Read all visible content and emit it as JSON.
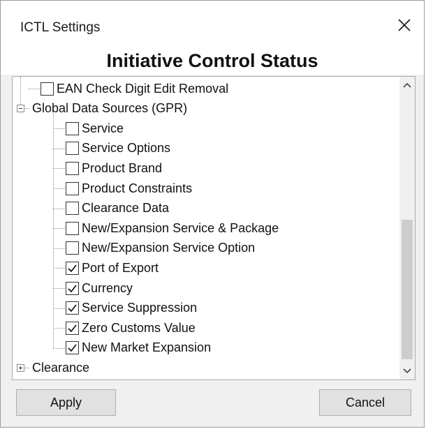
{
  "window": {
    "title": "ICTL Settings",
    "header": "Initiative Control Status"
  },
  "tree": {
    "items": [
      {
        "label": "EAN Check Digit Edit Removal",
        "checked": false,
        "level": 1
      },
      {
        "label": "Global Data Sources (GPR)",
        "node": true,
        "expanded": true,
        "level": 0
      },
      {
        "label": "Service",
        "checked": false,
        "level": 1
      },
      {
        "label": "Service Options",
        "checked": false,
        "level": 1
      },
      {
        "label": "Product Brand",
        "checked": false,
        "level": 1
      },
      {
        "label": "Product Constraints",
        "checked": false,
        "level": 1
      },
      {
        "label": "Clearance Data",
        "checked": false,
        "level": 1
      },
      {
        "label": "New/Expansion Service & Package",
        "checked": false,
        "level": 1
      },
      {
        "label": "New/Expansion Service Option",
        "checked": false,
        "level": 1
      },
      {
        "label": "Port of Export",
        "checked": true,
        "level": 1
      },
      {
        "label": "Currency",
        "checked": true,
        "level": 1
      },
      {
        "label": "Service Suppression",
        "checked": true,
        "level": 1
      },
      {
        "label": "Zero Customs Value",
        "checked": true,
        "level": 1
      },
      {
        "label": "New Market Expansion",
        "checked": true,
        "level": 1
      },
      {
        "label": "Clearance",
        "node": true,
        "expanded": false,
        "level": 0
      }
    ]
  },
  "buttons": {
    "apply": "Apply",
    "cancel": "Cancel"
  },
  "icons": {
    "close": "close-icon",
    "scroll_up": "chevron-up-icon",
    "scroll_down": "chevron-down-icon",
    "checkmark": "checkmark-icon"
  },
  "colors": {
    "panel_bg": "#ffffff",
    "window_bg": "#f0f0f0",
    "button_bg": "#e1e1e1",
    "scroll_thumb": "#cdcdcd"
  }
}
